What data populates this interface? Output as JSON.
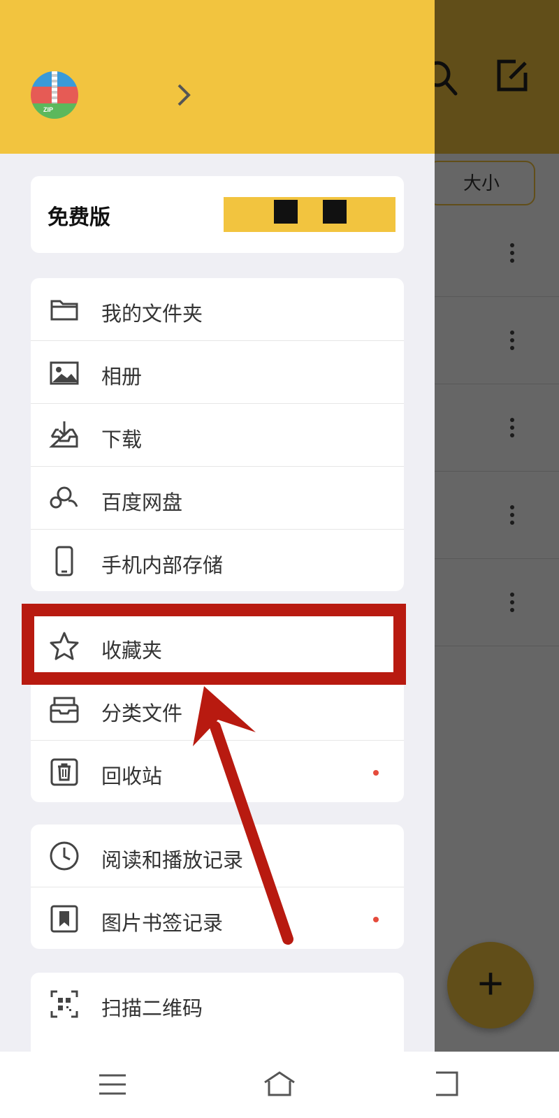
{
  "background_app": {
    "sort_button_label": "大小",
    "fab_label": "+"
  },
  "drawer": {
    "version_card": {
      "label": "免费版"
    },
    "group_storage": [
      {
        "label": "我的文件夹",
        "icon": "folder-icon"
      },
      {
        "label": "相册",
        "icon": "image-icon"
      },
      {
        "label": "下载",
        "icon": "download-tray-icon"
      },
      {
        "label": "百度网盘",
        "icon": "cloud-icon"
      },
      {
        "label": "手机内部存储",
        "icon": "phone-icon"
      }
    ],
    "group_files": [
      {
        "label": "收藏夹",
        "icon": "star-icon"
      },
      {
        "label": "分类文件",
        "icon": "box-icon"
      },
      {
        "label": "回收站",
        "icon": "trash-icon",
        "badge": true
      }
    ],
    "group_history": [
      {
        "label": "阅读和播放记录",
        "icon": "clock-icon"
      },
      {
        "label": "图片书签记录",
        "icon": "bookmark-icon",
        "badge": true
      }
    ],
    "group_tools": [
      {
        "label": "扫描二维码",
        "icon": "qr-scan-icon"
      }
    ]
  },
  "colors": {
    "accent": "#f2c43f",
    "highlight": "#b81a10",
    "badge": "#e54b3c"
  }
}
